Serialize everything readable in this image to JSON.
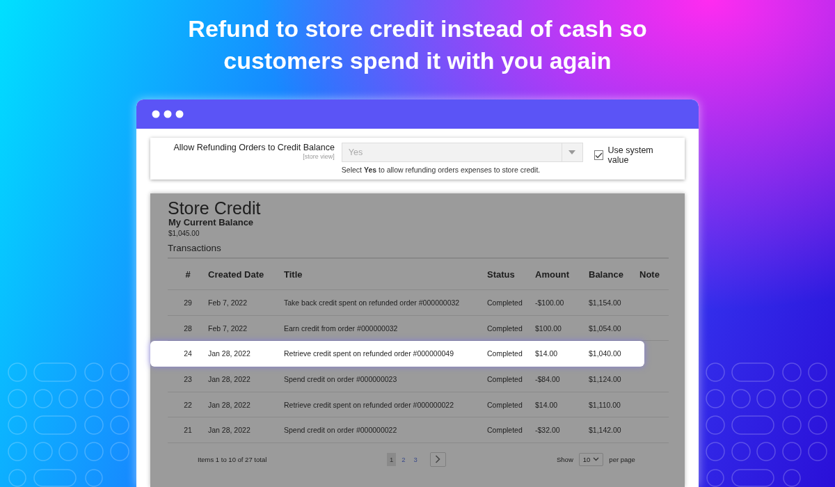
{
  "headline": "Refund to store credit instead of cash so customers spend it with you again",
  "config": {
    "label": "Allow Refunding Orders to Credit Balance",
    "scope": "[store view]",
    "select": {
      "value": "Yes",
      "disabled": true
    },
    "note": "Select **Yes** to allow refunding orders expenses to store credit.",
    "system_value": {
      "label": "Use system value",
      "checked": true
    }
  },
  "store_credit": {
    "title": "Store Credit",
    "balance_label": "My Current Balance",
    "balance": "$1,045.00",
    "transactions_heading": "Transactions",
    "table": {
      "columns": [
        "#",
        "Created Date",
        "Title",
        "Status",
        "Amount",
        "Balance",
        "Note"
      ],
      "rows": [
        {
          "cells": [
            "29",
            "Feb 7, 2022",
            "Take back credit spent on refunded order #000000032",
            "Completed",
            "-$100.00",
            "$1,154.00"
          ],
          "selected": false
        },
        {
          "cells": [
            "28",
            "Feb 7, 2022",
            "Earn credit from order #000000032",
            "Completed",
            "$100.00",
            "$1,054.00"
          ],
          "selected": false
        },
        {
          "cells": [
            "24",
            "Jan 28, 2022",
            "Retrieve credit spent on refunded order #000000049",
            "Completed",
            "$14.00",
            "$1,040.00"
          ],
          "selected": true
        },
        {
          "cells": [
            "23",
            "Jan 28, 2022",
            "Spend credit on order #000000023",
            "Completed",
            "-$84.00",
            "$1,124.00"
          ],
          "selected": false
        },
        {
          "cells": [
            "22",
            "Jan 28, 2022",
            "Retrieve credit spent on refunded order #000000022",
            "Completed",
            "$14.00",
            "$1,110.00"
          ],
          "selected": false
        },
        {
          "cells": [
            "21",
            "Jan 28, 2022",
            "Spend credit on order #000000022",
            "Completed",
            "-$32.00",
            "$1,142.00"
          ],
          "selected": false
        }
      ]
    },
    "pager": {
      "summary": "Items 1 to 10 of 27 total",
      "pages": [
        {
          "label": "1",
          "selected": true
        },
        {
          "label": "2",
          "selected": false
        },
        {
          "label": "3",
          "selected": false
        }
      ],
      "show_label": "Show",
      "per_page_value": "10",
      "per_page_label": "per page"
    }
  }
}
